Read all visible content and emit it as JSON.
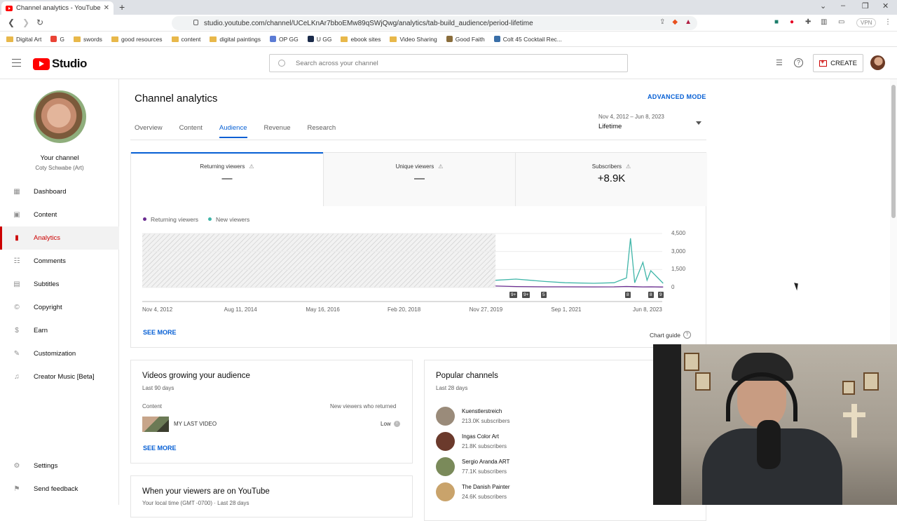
{
  "browser": {
    "tab_title": "Channel analytics - YouTube Studi",
    "url": "studio.youtube.com/channel/UCeLKnAr7bboEMw89qSWjQwg/analytics/tab-build_audience/period-lifetime",
    "vpn_label": "VPN",
    "bookmarks": [
      "Digital Art",
      "G",
      "swords",
      "good resources",
      "content",
      "digital paintings",
      "OP GG",
      "U GG",
      "ebook sites",
      "Video Sharing",
      "Good Faith",
      "Colt 45 Cocktail Rec..."
    ]
  },
  "header": {
    "logo_text": "Studio",
    "search_placeholder": "Search across your channel",
    "create_label": "CREATE"
  },
  "sidebar": {
    "your_channel": "Your channel",
    "channel_name": "Coty Schwabe (Art)",
    "items": [
      {
        "label": "Dashboard",
        "icon": "dashboard-icon"
      },
      {
        "label": "Content",
        "icon": "content-icon"
      },
      {
        "label": "Analytics",
        "icon": "analytics-icon"
      },
      {
        "label": "Comments",
        "icon": "comments-icon"
      },
      {
        "label": "Subtitles",
        "icon": "subtitles-icon"
      },
      {
        "label": "Copyright",
        "icon": "copyright-icon"
      },
      {
        "label": "Earn",
        "icon": "earn-icon"
      },
      {
        "label": "Customization",
        "icon": "customization-icon"
      },
      {
        "label": "Creator Music [Beta]",
        "icon": "creator-music-icon"
      }
    ],
    "settings": "Settings",
    "feedback": "Send feedback"
  },
  "main": {
    "title": "Channel analytics",
    "advanced_mode": "ADVANCED MODE",
    "tabs": [
      "Overview",
      "Content",
      "Audience",
      "Revenue",
      "Research"
    ],
    "active_tab": "Audience",
    "date_range": "Nov 4, 2012 – Jun 8, 2023",
    "date_label": "Lifetime",
    "metrics": [
      {
        "label": "Returning viewers",
        "value": "—"
      },
      {
        "label": "Unique viewers",
        "value": "—"
      },
      {
        "label": "Subscribers",
        "value": "+8.9K"
      }
    ],
    "legend": [
      {
        "label": "Returning viewers",
        "color": "#6a2c91"
      },
      {
        "label": "New viewers",
        "color": "#3fb5a8"
      }
    ],
    "see_more": "SEE MORE",
    "chart_guide": "Chart guide"
  },
  "chart_data": {
    "type": "line",
    "x_ticks": [
      "Nov 4, 2012",
      "Aug 11, 2014",
      "May 16, 2016",
      "Feb 20, 2018",
      "Nov 27, 2019",
      "Sep 1, 2021",
      "Jun 8, 2023"
    ],
    "y_ticks": [
      "4,500",
      "3,000",
      "1,500",
      "0"
    ],
    "ylim": [
      0,
      4500
    ],
    "shaded_region_end": "Jan 2020",
    "markers": [
      "9+",
      "9+",
      "5",
      "8",
      "8",
      "9"
    ],
    "series": [
      {
        "name": "Returning viewers",
        "color": "#6a2c91",
        "x": [
          "2020-01",
          "2020-06",
          "2021-01",
          "2021-06",
          "2022-01",
          "2022-06",
          "2022-09",
          "2022-11",
          "2023-01",
          "2023-03",
          "2023-06"
        ],
        "values": [
          120,
          80,
          60,
          60,
          50,
          60,
          90,
          70,
          50,
          60,
          40
        ]
      },
      {
        "name": "New viewers",
        "color": "#3fb5a8",
        "x": [
          "2020-01",
          "2020-06",
          "2021-01",
          "2021-06",
          "2022-01",
          "2022-06",
          "2022-09",
          "2022-10",
          "2022-11",
          "2023-01",
          "2023-02",
          "2023-03",
          "2023-06"
        ],
        "values": [
          600,
          700,
          500,
          400,
          350,
          400,
          800,
          4100,
          400,
          2100,
          600,
          1400,
          350
        ]
      }
    ]
  },
  "growing_card": {
    "title": "Videos growing your audience",
    "subtitle": "Last 90 days",
    "col_content": "Content",
    "col_metric": "New viewers who returned",
    "video_title": "MY LAST VIDEO",
    "video_value": "Low",
    "see_more": "SEE MORE"
  },
  "popular_card": {
    "title": "Popular channels",
    "subtitle": "Last 28 days",
    "channels": [
      {
        "name": "Kuenstlerstreich",
        "subs": "213.0K subscribers",
        "color": "#9a8b7a"
      },
      {
        "name": "Ingas Color Art",
        "subs": "21.8K subscribers",
        "color": "#6b3a2c"
      },
      {
        "name": "Sergio Aranda ART",
        "subs": "77.1K subscribers",
        "color": "#7a8a5a"
      },
      {
        "name": "The Danish Painter",
        "subs": "24.6K subscribers",
        "color": "#c9a36b"
      }
    ]
  },
  "when_card": {
    "title": "When your viewers are on YouTube",
    "subtitle": "Your local time (GMT -0700) · Last 28 days"
  }
}
